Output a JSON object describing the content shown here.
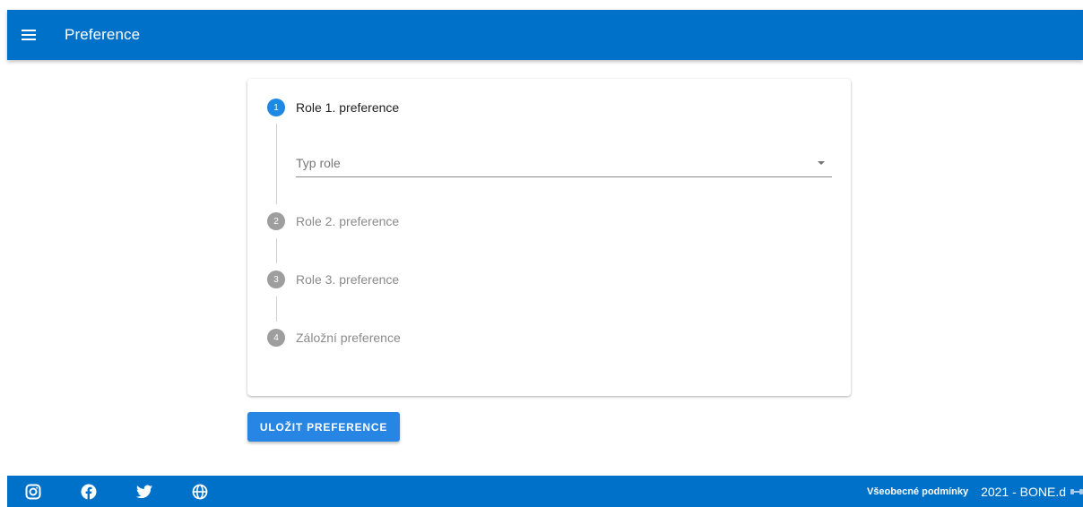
{
  "header": {
    "title": "Preference",
    "bg_color": "#0071c9"
  },
  "stepper": {
    "active_color": "#1e88e5",
    "inactive_color": "#9e9e9e",
    "steps": [
      {
        "number": "1",
        "label": "Role 1. preference",
        "active": true
      },
      {
        "number": "2",
        "label": "Role 2. preference",
        "active": false
      },
      {
        "number": "3",
        "label": "Role 3. preference",
        "active": false
      },
      {
        "number": "4",
        "label": "Záložní preference",
        "active": false
      }
    ],
    "role_select": {
      "placeholder": "Typ role",
      "value": ""
    }
  },
  "actions": {
    "save_label": "ULOŽIT PREFERENCE"
  },
  "footer": {
    "social_icons": [
      "instagram-icon",
      "facebook-icon",
      "twitter-icon",
      "globe-icon"
    ],
    "terms_label": "Všeobecné podmínky",
    "copyright": "2021 - BONE.d"
  }
}
